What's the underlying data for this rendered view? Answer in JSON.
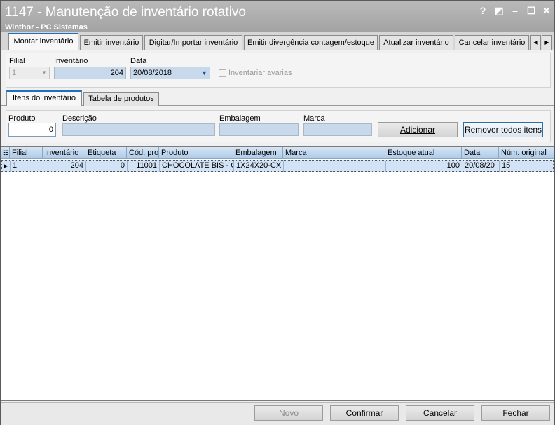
{
  "window": {
    "title": "1147 - Manutenção de inventário rotativo",
    "subtitle": "Winthor - PC Sistemas",
    "controls": {
      "help": "?",
      "restore": "◩",
      "minimize": "–",
      "maximize": "☐",
      "close": "✕"
    }
  },
  "tabs": [
    {
      "label": "Montar inventário",
      "active": true
    },
    {
      "label": "Emitir inventário"
    },
    {
      "label": "Digitar/Importar inventário"
    },
    {
      "label": "Emitir divergência contagem/estoque"
    },
    {
      "label": "Atualizar inventário"
    },
    {
      "label": "Cancelar inventário"
    }
  ],
  "tab_scroll": {
    "left": "◀",
    "right": "▶"
  },
  "header_form": {
    "filial": {
      "label": "Filial",
      "value": "1"
    },
    "inventario": {
      "label": "Inventário",
      "value": "204"
    },
    "data": {
      "label": "Data",
      "value": "20/08/2018"
    },
    "avarias": {
      "label": "Inventariar avarias",
      "checked": false
    }
  },
  "subtabs": [
    {
      "label": "Itens do inventário",
      "active": true
    },
    {
      "label": "Tabela de produtos"
    }
  ],
  "item_form": {
    "produto": {
      "label": "Produto",
      "value": "0"
    },
    "descricao": {
      "label": "Descrição",
      "value": ""
    },
    "embalagem": {
      "label": "Embalagem",
      "value": ""
    },
    "marca": {
      "label": "Marca",
      "value": ""
    },
    "add_button": "Adicionar",
    "remove_all_button": "Remover todos itens"
  },
  "grid": {
    "columns": [
      "Filial",
      "Inventário",
      "Etiqueta",
      "Cód. prod.",
      "Produto",
      "Embalagem",
      "Marca",
      "Estoque atual",
      "Data",
      "Núm. original"
    ],
    "rows": [
      {
        "filial": "1",
        "inventario": "204",
        "etiqueta": "0",
        "cod": "11001",
        "produto": "CHOCOLATE BIS - C",
        "embalagem": "1X24X20-CX",
        "marca": "",
        "estoque": "100",
        "data": "20/08/20",
        "num_original": "15"
      }
    ]
  },
  "footer": {
    "novo": "Novo",
    "confirmar": "Confirmar",
    "cancelar": "Cancelar",
    "fechar": "Fechar"
  }
}
